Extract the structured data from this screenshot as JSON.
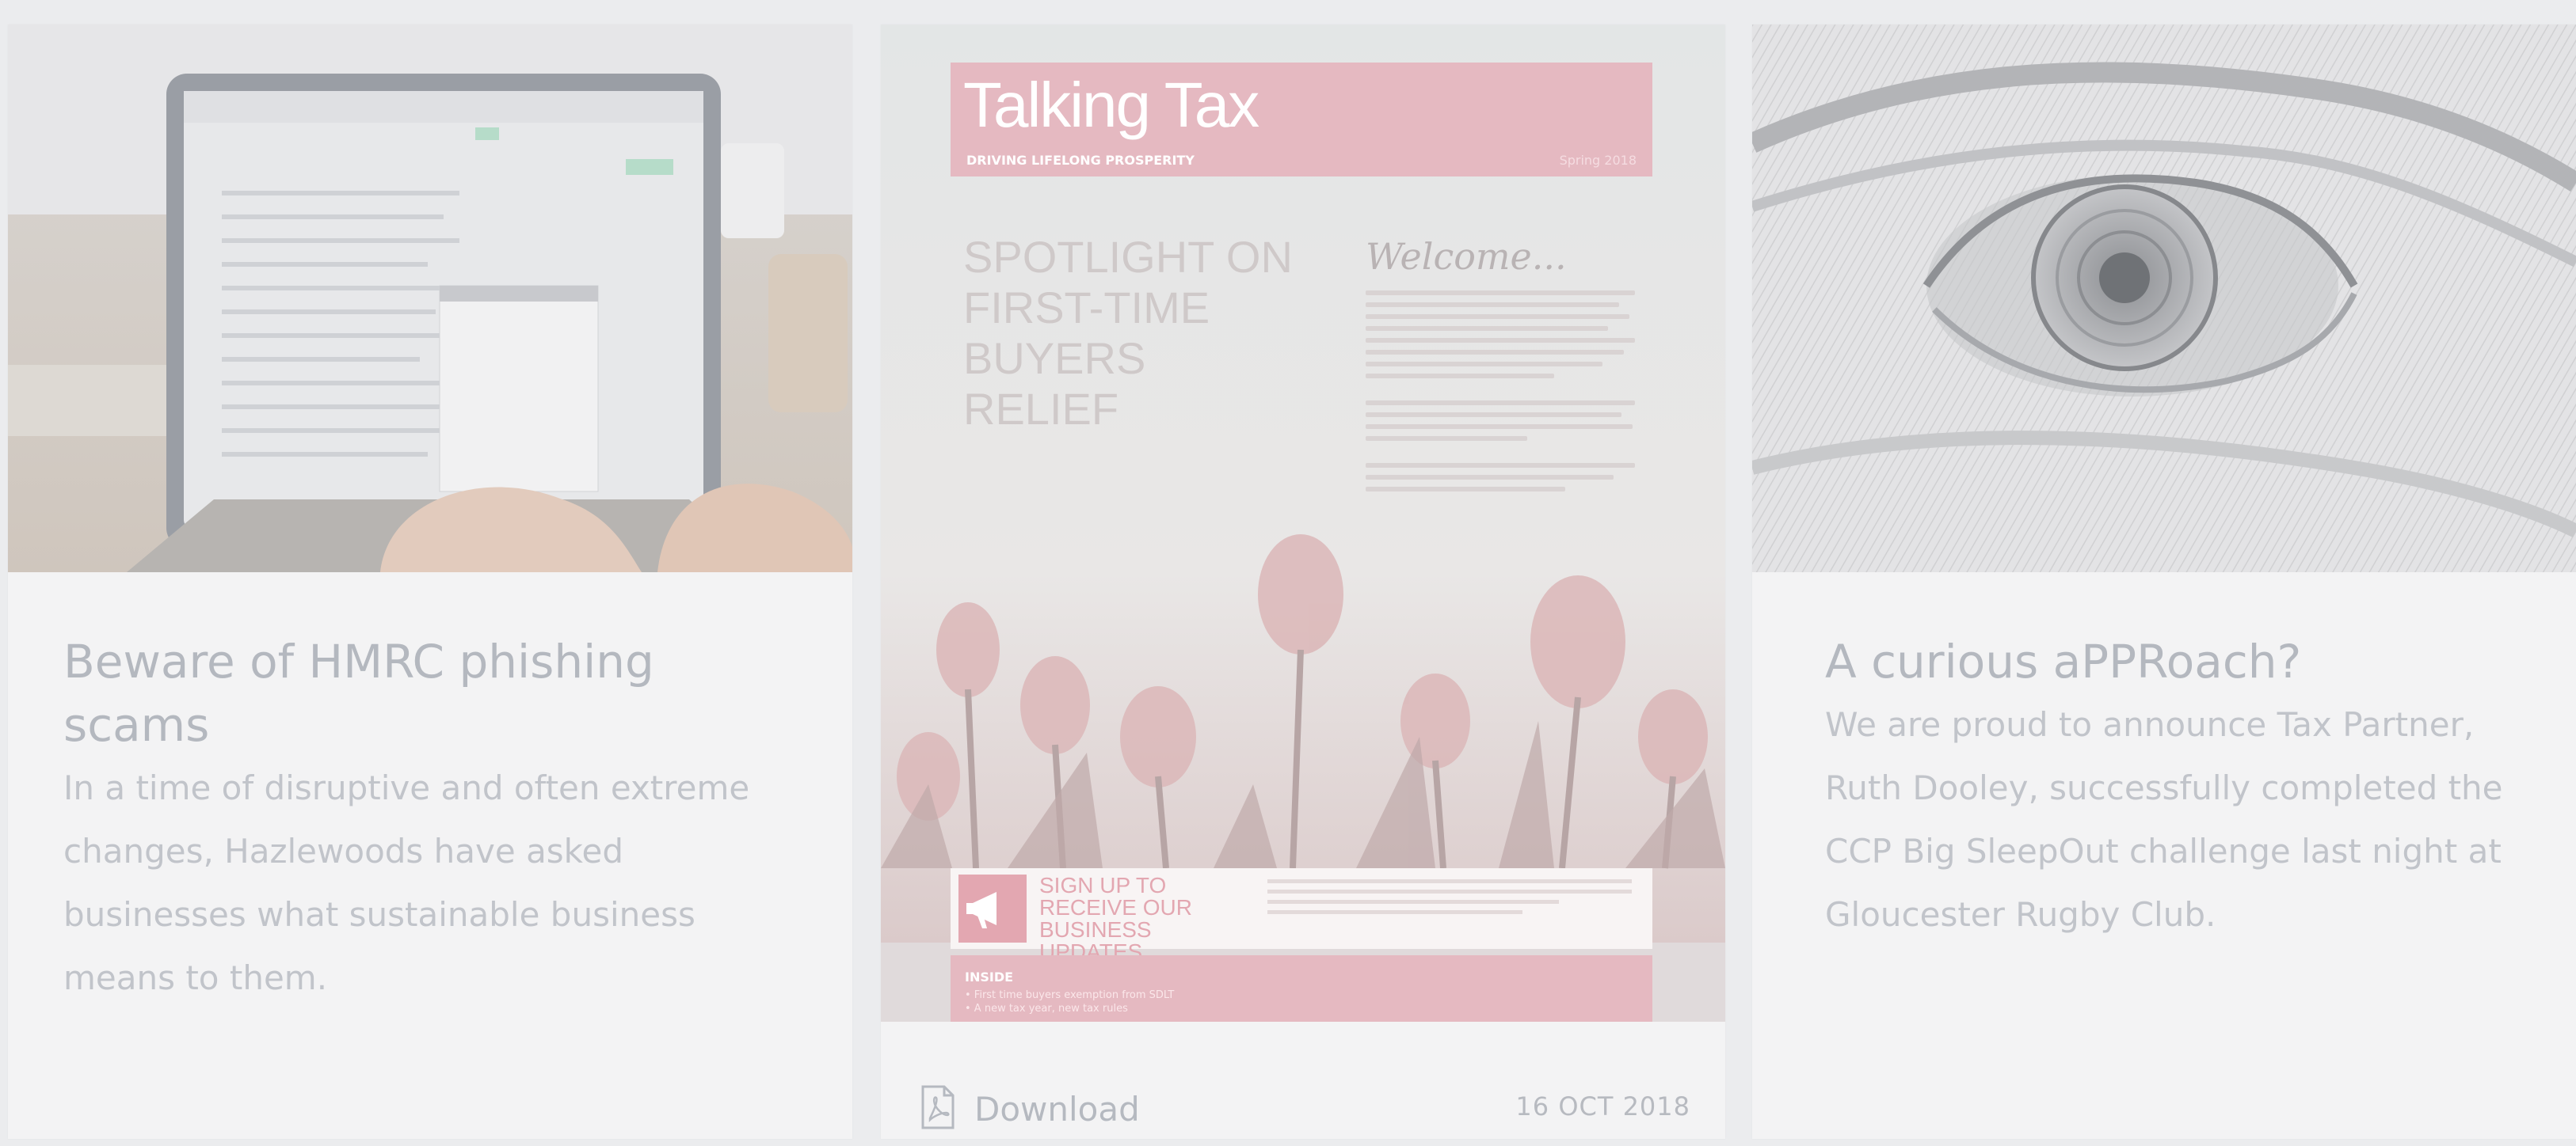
{
  "cards": [
    {
      "title": "Beware of HMRC phishing scams",
      "excerpt": "In a time of disruptive and often extreme changes, Hazlewoods have asked businesses what sustainable business means to them."
    },
    {
      "newsletter": {
        "title": "Talking Tax",
        "tagline": "DRIVING LIFELONG PROSPERITY",
        "season": "Spring 2018",
        "headline": "SPOTLIGHT ON FIRST-TIME BUYERS RELIEF",
        "welcome": "Welcome...",
        "signup": "SIGN UP TO RECEIVE OUR BUSINESS UPDATES",
        "inside_label": "INSIDE",
        "inside_text": "• First time buyers exemption from SDLT\n• A new tax year, new tax rules"
      },
      "download_label": "Download",
      "date": "16 OCT 2018",
      "icons": {
        "download": "pdf-file-icon"
      }
    },
    {
      "title": "A curious aPPRoach?",
      "excerpt": "We are proud to announce Tax Partner, Ruth Dooley, successfully completed the CCP Big SleepOut challenge last night at Gloucester Rugby Club."
    }
  ],
  "colors": {
    "page_background": "#ebecee",
    "card_background": "#f3f3f4",
    "title_text": "#b4b8bf",
    "body_text": "#c1c4ca",
    "newsletter_accent": "#e5b9c1"
  }
}
